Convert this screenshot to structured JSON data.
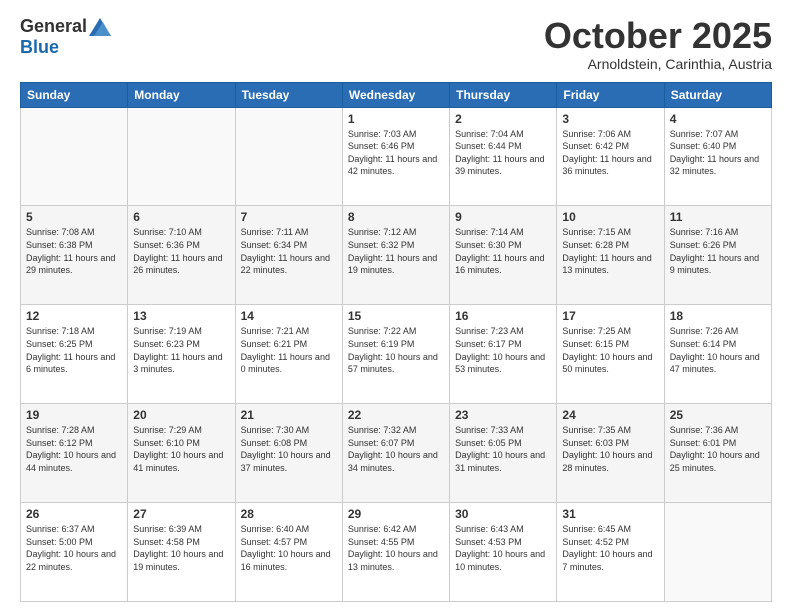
{
  "header": {
    "logo_general": "General",
    "logo_blue": "Blue",
    "month": "October 2025",
    "location": "Arnoldstein, Carinthia, Austria"
  },
  "days_of_week": [
    "Sunday",
    "Monday",
    "Tuesday",
    "Wednesday",
    "Thursday",
    "Friday",
    "Saturday"
  ],
  "weeks": [
    [
      {
        "day": "",
        "sunrise": "",
        "sunset": "",
        "daylight": ""
      },
      {
        "day": "",
        "sunrise": "",
        "sunset": "",
        "daylight": ""
      },
      {
        "day": "",
        "sunrise": "",
        "sunset": "",
        "daylight": ""
      },
      {
        "day": "1",
        "sunrise": "Sunrise: 7:03 AM",
        "sunset": "Sunset: 6:46 PM",
        "daylight": "Daylight: 11 hours and 42 minutes."
      },
      {
        "day": "2",
        "sunrise": "Sunrise: 7:04 AM",
        "sunset": "Sunset: 6:44 PM",
        "daylight": "Daylight: 11 hours and 39 minutes."
      },
      {
        "day": "3",
        "sunrise": "Sunrise: 7:06 AM",
        "sunset": "Sunset: 6:42 PM",
        "daylight": "Daylight: 11 hours and 36 minutes."
      },
      {
        "day": "4",
        "sunrise": "Sunrise: 7:07 AM",
        "sunset": "Sunset: 6:40 PM",
        "daylight": "Daylight: 11 hours and 32 minutes."
      }
    ],
    [
      {
        "day": "5",
        "sunrise": "Sunrise: 7:08 AM",
        "sunset": "Sunset: 6:38 PM",
        "daylight": "Daylight: 11 hours and 29 minutes."
      },
      {
        "day": "6",
        "sunrise": "Sunrise: 7:10 AM",
        "sunset": "Sunset: 6:36 PM",
        "daylight": "Daylight: 11 hours and 26 minutes."
      },
      {
        "day": "7",
        "sunrise": "Sunrise: 7:11 AM",
        "sunset": "Sunset: 6:34 PM",
        "daylight": "Daylight: 11 hours and 22 minutes."
      },
      {
        "day": "8",
        "sunrise": "Sunrise: 7:12 AM",
        "sunset": "Sunset: 6:32 PM",
        "daylight": "Daylight: 11 hours and 19 minutes."
      },
      {
        "day": "9",
        "sunrise": "Sunrise: 7:14 AM",
        "sunset": "Sunset: 6:30 PM",
        "daylight": "Daylight: 11 hours and 16 minutes."
      },
      {
        "day": "10",
        "sunrise": "Sunrise: 7:15 AM",
        "sunset": "Sunset: 6:28 PM",
        "daylight": "Daylight: 11 hours and 13 minutes."
      },
      {
        "day": "11",
        "sunrise": "Sunrise: 7:16 AM",
        "sunset": "Sunset: 6:26 PM",
        "daylight": "Daylight: 11 hours and 9 minutes."
      }
    ],
    [
      {
        "day": "12",
        "sunrise": "Sunrise: 7:18 AM",
        "sunset": "Sunset: 6:25 PM",
        "daylight": "Daylight: 11 hours and 6 minutes."
      },
      {
        "day": "13",
        "sunrise": "Sunrise: 7:19 AM",
        "sunset": "Sunset: 6:23 PM",
        "daylight": "Daylight: 11 hours and 3 minutes."
      },
      {
        "day": "14",
        "sunrise": "Sunrise: 7:21 AM",
        "sunset": "Sunset: 6:21 PM",
        "daylight": "Daylight: 11 hours and 0 minutes."
      },
      {
        "day": "15",
        "sunrise": "Sunrise: 7:22 AM",
        "sunset": "Sunset: 6:19 PM",
        "daylight": "Daylight: 10 hours and 57 minutes."
      },
      {
        "day": "16",
        "sunrise": "Sunrise: 7:23 AM",
        "sunset": "Sunset: 6:17 PM",
        "daylight": "Daylight: 10 hours and 53 minutes."
      },
      {
        "day": "17",
        "sunrise": "Sunrise: 7:25 AM",
        "sunset": "Sunset: 6:15 PM",
        "daylight": "Daylight: 10 hours and 50 minutes."
      },
      {
        "day": "18",
        "sunrise": "Sunrise: 7:26 AM",
        "sunset": "Sunset: 6:14 PM",
        "daylight": "Daylight: 10 hours and 47 minutes."
      }
    ],
    [
      {
        "day": "19",
        "sunrise": "Sunrise: 7:28 AM",
        "sunset": "Sunset: 6:12 PM",
        "daylight": "Daylight: 10 hours and 44 minutes."
      },
      {
        "day": "20",
        "sunrise": "Sunrise: 7:29 AM",
        "sunset": "Sunset: 6:10 PM",
        "daylight": "Daylight: 10 hours and 41 minutes."
      },
      {
        "day": "21",
        "sunrise": "Sunrise: 7:30 AM",
        "sunset": "Sunset: 6:08 PM",
        "daylight": "Daylight: 10 hours and 37 minutes."
      },
      {
        "day": "22",
        "sunrise": "Sunrise: 7:32 AM",
        "sunset": "Sunset: 6:07 PM",
        "daylight": "Daylight: 10 hours and 34 minutes."
      },
      {
        "day": "23",
        "sunrise": "Sunrise: 7:33 AM",
        "sunset": "Sunset: 6:05 PM",
        "daylight": "Daylight: 10 hours and 31 minutes."
      },
      {
        "day": "24",
        "sunrise": "Sunrise: 7:35 AM",
        "sunset": "Sunset: 6:03 PM",
        "daylight": "Daylight: 10 hours and 28 minutes."
      },
      {
        "day": "25",
        "sunrise": "Sunrise: 7:36 AM",
        "sunset": "Sunset: 6:01 PM",
        "daylight": "Daylight: 10 hours and 25 minutes."
      }
    ],
    [
      {
        "day": "26",
        "sunrise": "Sunrise: 6:37 AM",
        "sunset": "Sunset: 5:00 PM",
        "daylight": "Daylight: 10 hours and 22 minutes."
      },
      {
        "day": "27",
        "sunrise": "Sunrise: 6:39 AM",
        "sunset": "Sunset: 4:58 PM",
        "daylight": "Daylight: 10 hours and 19 minutes."
      },
      {
        "day": "28",
        "sunrise": "Sunrise: 6:40 AM",
        "sunset": "Sunset: 4:57 PM",
        "daylight": "Daylight: 10 hours and 16 minutes."
      },
      {
        "day": "29",
        "sunrise": "Sunrise: 6:42 AM",
        "sunset": "Sunset: 4:55 PM",
        "daylight": "Daylight: 10 hours and 13 minutes."
      },
      {
        "day": "30",
        "sunrise": "Sunrise: 6:43 AM",
        "sunset": "Sunset: 4:53 PM",
        "daylight": "Daylight: 10 hours and 10 minutes."
      },
      {
        "day": "31",
        "sunrise": "Sunrise: 6:45 AM",
        "sunset": "Sunset: 4:52 PM",
        "daylight": "Daylight: 10 hours and 7 minutes."
      },
      {
        "day": "",
        "sunrise": "",
        "sunset": "",
        "daylight": ""
      }
    ]
  ]
}
